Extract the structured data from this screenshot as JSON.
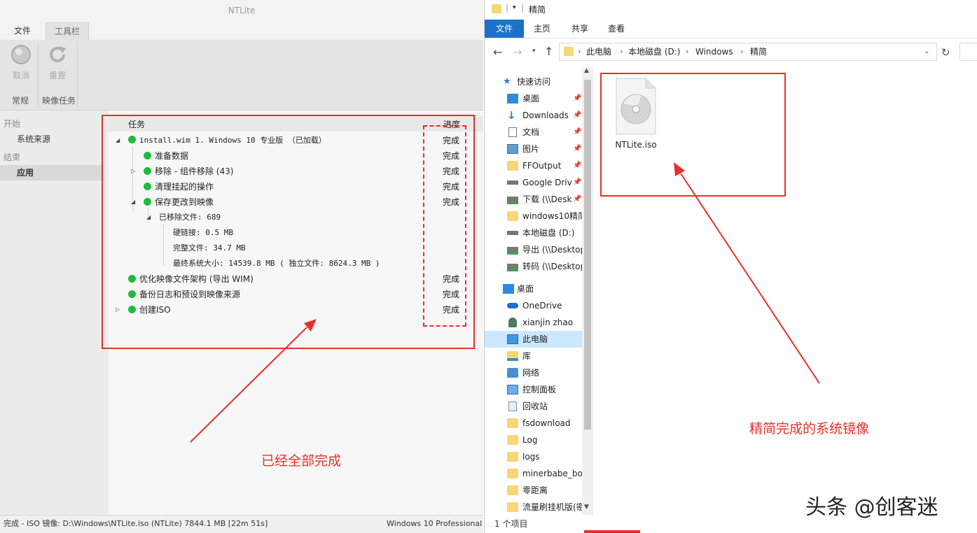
{
  "ntlite": {
    "window_title": "NTLite",
    "tabs": [
      "文件",
      "工具栏"
    ],
    "ribbon": {
      "buttons": [
        {
          "label": "取消",
          "icon": "cancel-circle-icon"
        },
        {
          "label": "重置",
          "icon": "refresh-icon"
        }
      ],
      "groups": [
        "常规",
        "映像任务"
      ]
    },
    "sidebar": {
      "sections": [
        {
          "heading": "开始",
          "items": [
            "系统来源"
          ]
        },
        {
          "heading": "结束",
          "items": [
            "应用"
          ]
        }
      ],
      "active": "应用"
    },
    "task_table": {
      "headers": {
        "task": "任务",
        "progress": "进度"
      },
      "rows": [
        {
          "text": "install.wim 1. Windows 10 专业版 （已加载）",
          "progress": "完成"
        },
        {
          "text": "准备数据",
          "progress": "完成"
        },
        {
          "text": "移除 - 组件移除 (43)",
          "progress": "完成"
        },
        {
          "text": "清理挂起的操作",
          "progress": "完成"
        },
        {
          "text": "保存更改到映像",
          "progress": "完成"
        },
        {
          "text": "已移除文件: 689",
          "progress": ""
        },
        {
          "text": "硬链接: 0.5 MB",
          "progress": ""
        },
        {
          "text": "完整文件: 34.7 MB",
          "progress": ""
        },
        {
          "text": "最终系统大小: 14539.8 MB ( 独立文件: 8624.3 MB )",
          "progress": ""
        },
        {
          "text": "优化映像文件架构 (导出 WIM)",
          "progress": "完成"
        },
        {
          "text": "备份日志和预设到映像来源",
          "progress": "完成"
        },
        {
          "text": "创建ISO",
          "progress": "完成"
        }
      ]
    },
    "status_left": "完成 - ISO 镜像: D:\\Windows\\NTLite.iso (NTLite) 7844.1 MB [22m 51s]",
    "status_right": "Windows 10 Professional ("
  },
  "explorer": {
    "title": "精简",
    "ribbon_tabs": [
      "文件",
      "主页",
      "共享",
      "查看"
    ],
    "breadcrumb": [
      "此电脑",
      "本地磁盘 (D:)",
      "Windows",
      "精简"
    ],
    "nav": {
      "quick_access": "快速访问",
      "quick_items": [
        {
          "label": "桌面",
          "icon": "desktop-icon",
          "pinned": true
        },
        {
          "label": "Downloads",
          "icon": "download-arrow-icon",
          "pinned": true
        },
        {
          "label": "文档",
          "icon": "document-icon",
          "pinned": true
        },
        {
          "label": "图片",
          "icon": "picture-icon",
          "pinned": true
        },
        {
          "label": "FFOutput",
          "icon": "folder-icon",
          "pinned": true
        },
        {
          "label": "Google Driv",
          "icon": "drive-icon",
          "pinned": true
        },
        {
          "label": "下载 (\\\\Desk",
          "icon": "network-drive-icon",
          "pinned": true
        },
        {
          "label": "windows10精简",
          "icon": "folder-icon",
          "pinned": false
        },
        {
          "label": "本地磁盘 (D:)",
          "icon": "drive-icon",
          "pinned": false
        },
        {
          "label": "导出 (\\\\Desktop",
          "icon": "network-drive-icon",
          "pinned": false
        },
        {
          "label": "转码 (\\\\Desktop",
          "icon": "network-drive-icon",
          "pinned": false
        }
      ],
      "desktop": "桌面",
      "desktop_items": [
        {
          "label": "OneDrive",
          "icon": "cloud-icon"
        },
        {
          "label": "xianjin zhao",
          "icon": "user-icon"
        },
        {
          "label": "此电脑",
          "icon": "computer-icon"
        },
        {
          "label": "库",
          "icon": "library-icon"
        },
        {
          "label": "网络",
          "icon": "network-icon"
        },
        {
          "label": "控制面板",
          "icon": "control-panel-icon"
        },
        {
          "label": "回收站",
          "icon": "recycle-bin-icon"
        },
        {
          "label": "fsdownload",
          "icon": "folder-icon"
        },
        {
          "label": "Log",
          "icon": "folder-icon"
        },
        {
          "label": "logs",
          "icon": "folder-icon"
        },
        {
          "label": "minerbabe_boo",
          "icon": "folder-icon"
        },
        {
          "label": "零距离",
          "icon": "folder-icon"
        },
        {
          "label": "流量刷挂机版(密",
          "icon": "folder-icon"
        }
      ],
      "active": "此电脑"
    },
    "file": {
      "name": "NTLite.iso",
      "icon": "disc-image-icon"
    },
    "status": "1 个项目"
  },
  "annotations": {
    "left_note": "已经全部完成",
    "right_note": "精简完成的系统镜像",
    "color": "#e8302a"
  },
  "watermark": "头条 @创客迷"
}
